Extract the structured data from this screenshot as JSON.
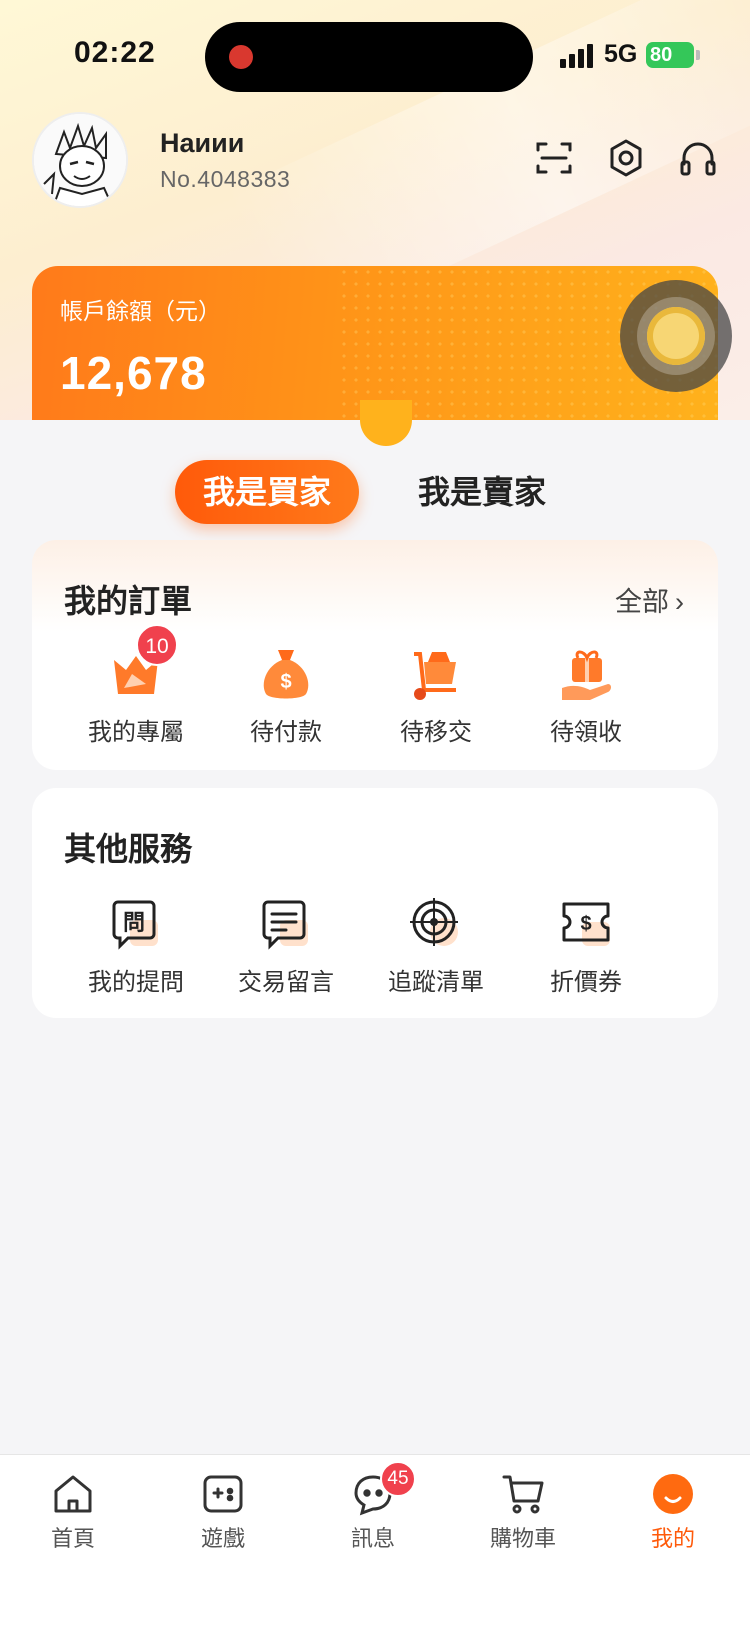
{
  "status": {
    "time": "02:22",
    "network": "5G",
    "battery": "80"
  },
  "profile": {
    "name": "Наиии",
    "number": "No.4048383"
  },
  "header_icons": [
    "scan-icon",
    "settings-icon",
    "headset-icon"
  ],
  "balance": {
    "label": "帳戶餘額（元）",
    "value": "12,678"
  },
  "role_tabs": {
    "buyer": "我是買家",
    "seller": "我是賣家",
    "active": "buyer"
  },
  "orders": {
    "title": "我的訂單",
    "more": "全部",
    "items": [
      {
        "label": "我的專屬",
        "icon": "crown-icon",
        "badge": "10"
      },
      {
        "label": "待付款",
        "icon": "money-bag-icon"
      },
      {
        "label": "待移交",
        "icon": "cart-box-icon"
      },
      {
        "label": "待領收",
        "icon": "gift-hand-icon"
      }
    ]
  },
  "services": {
    "title": "其他服務",
    "items": [
      {
        "label": "我的提問",
        "icon": "question-bubble-icon"
      },
      {
        "label": "交易留言",
        "icon": "message-icon"
      },
      {
        "label": "追蹤清單",
        "icon": "target-icon"
      },
      {
        "label": "折價券",
        "icon": "coupon-icon"
      }
    ]
  },
  "tabbar": {
    "items": [
      {
        "label": "首頁",
        "icon": "home-icon"
      },
      {
        "label": "遊戲",
        "icon": "gamepad-icon"
      },
      {
        "label": "訊息",
        "icon": "chat-icon",
        "badge": "45"
      },
      {
        "label": "購物車",
        "icon": "cart-icon"
      },
      {
        "label": "我的",
        "icon": "profile-smile-icon",
        "active": true
      }
    ]
  },
  "colors": {
    "accent": "#ff5a0a",
    "badge": "#f0414d",
    "battery": "#34c759"
  }
}
